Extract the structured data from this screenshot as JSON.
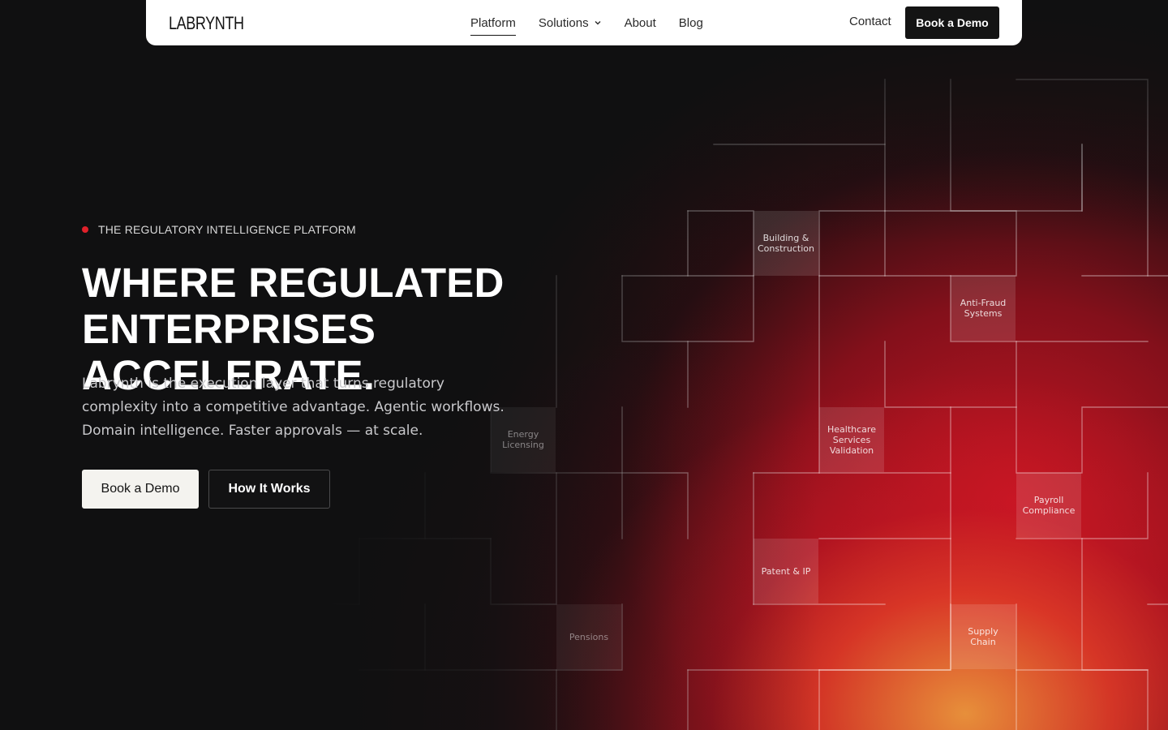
{
  "nav": {
    "logo": "LABRYNTH",
    "links": [
      {
        "label": "Platform",
        "active": true
      },
      {
        "label": "Solutions",
        "has_dropdown": true
      },
      {
        "label": "About"
      },
      {
        "label": "Blog"
      }
    ],
    "contact": "Contact",
    "cta": "Book a Demo"
  },
  "hero": {
    "eyebrow": "THE REGULATORY INTELLIGENCE PLATFORM",
    "headline_line1": "WHERE REGULATED",
    "headline_line2": "ENTERPRISES ACCELERATE.",
    "subtext": "Labrynth is the execution layer that turns regulatory complexity into a competitive advantage. Agentic workflows. Domain intelligence. Faster approvals — at scale.",
    "primary_cta": "Book a Demo",
    "secondary_cta": "How It Works"
  },
  "maze_tiles": {
    "building": "Building & Construction",
    "antifraud": "Anti-Fraud Systems",
    "energy": "Energy Licensing",
    "healthcare": "Healthcare Services Validation",
    "payroll": "Payroll Compliance",
    "patent": "Patent & IP",
    "pensions": "Pensions",
    "supply": "Supply Chain"
  },
  "colors": {
    "accent_red": "#e0212a",
    "background": "#101011",
    "nav_bg": "#ffffff",
    "cta_dark": "#141414",
    "cta_light": "#f4f3ef"
  }
}
